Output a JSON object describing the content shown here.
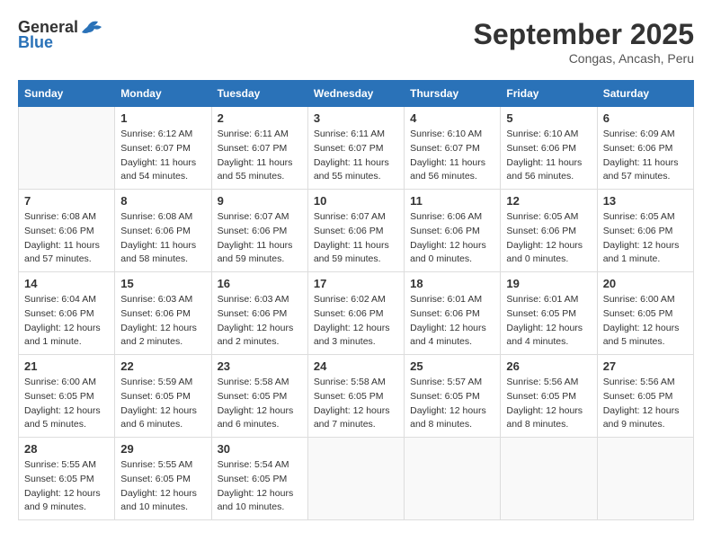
{
  "logo": {
    "text1": "General",
    "text2": "Blue"
  },
  "title": "September 2025",
  "subtitle": "Congas, Ancash, Peru",
  "days_of_week": [
    "Sunday",
    "Monday",
    "Tuesday",
    "Wednesday",
    "Thursday",
    "Friday",
    "Saturday"
  ],
  "weeks": [
    [
      {
        "day": "",
        "info": ""
      },
      {
        "day": "1",
        "info": "Sunrise: 6:12 AM\nSunset: 6:07 PM\nDaylight: 11 hours\nand 54 minutes."
      },
      {
        "day": "2",
        "info": "Sunrise: 6:11 AM\nSunset: 6:07 PM\nDaylight: 11 hours\nand 55 minutes."
      },
      {
        "day": "3",
        "info": "Sunrise: 6:11 AM\nSunset: 6:07 PM\nDaylight: 11 hours\nand 55 minutes."
      },
      {
        "day": "4",
        "info": "Sunrise: 6:10 AM\nSunset: 6:07 PM\nDaylight: 11 hours\nand 56 minutes."
      },
      {
        "day": "5",
        "info": "Sunrise: 6:10 AM\nSunset: 6:06 PM\nDaylight: 11 hours\nand 56 minutes."
      },
      {
        "day": "6",
        "info": "Sunrise: 6:09 AM\nSunset: 6:06 PM\nDaylight: 11 hours\nand 57 minutes."
      }
    ],
    [
      {
        "day": "7",
        "info": "Sunrise: 6:08 AM\nSunset: 6:06 PM\nDaylight: 11 hours\nand 57 minutes."
      },
      {
        "day": "8",
        "info": "Sunrise: 6:08 AM\nSunset: 6:06 PM\nDaylight: 11 hours\nand 58 minutes."
      },
      {
        "day": "9",
        "info": "Sunrise: 6:07 AM\nSunset: 6:06 PM\nDaylight: 11 hours\nand 59 minutes."
      },
      {
        "day": "10",
        "info": "Sunrise: 6:07 AM\nSunset: 6:06 PM\nDaylight: 11 hours\nand 59 minutes."
      },
      {
        "day": "11",
        "info": "Sunrise: 6:06 AM\nSunset: 6:06 PM\nDaylight: 12 hours\nand 0 minutes."
      },
      {
        "day": "12",
        "info": "Sunrise: 6:05 AM\nSunset: 6:06 PM\nDaylight: 12 hours\nand 0 minutes."
      },
      {
        "day": "13",
        "info": "Sunrise: 6:05 AM\nSunset: 6:06 PM\nDaylight: 12 hours\nand 1 minute."
      }
    ],
    [
      {
        "day": "14",
        "info": "Sunrise: 6:04 AM\nSunset: 6:06 PM\nDaylight: 12 hours\nand 1 minute."
      },
      {
        "day": "15",
        "info": "Sunrise: 6:03 AM\nSunset: 6:06 PM\nDaylight: 12 hours\nand 2 minutes."
      },
      {
        "day": "16",
        "info": "Sunrise: 6:03 AM\nSunset: 6:06 PM\nDaylight: 12 hours\nand 2 minutes."
      },
      {
        "day": "17",
        "info": "Sunrise: 6:02 AM\nSunset: 6:06 PM\nDaylight: 12 hours\nand 3 minutes."
      },
      {
        "day": "18",
        "info": "Sunrise: 6:01 AM\nSunset: 6:06 PM\nDaylight: 12 hours\nand 4 minutes."
      },
      {
        "day": "19",
        "info": "Sunrise: 6:01 AM\nSunset: 6:05 PM\nDaylight: 12 hours\nand 4 minutes."
      },
      {
        "day": "20",
        "info": "Sunrise: 6:00 AM\nSunset: 6:05 PM\nDaylight: 12 hours\nand 5 minutes."
      }
    ],
    [
      {
        "day": "21",
        "info": "Sunrise: 6:00 AM\nSunset: 6:05 PM\nDaylight: 12 hours\nand 5 minutes."
      },
      {
        "day": "22",
        "info": "Sunrise: 5:59 AM\nSunset: 6:05 PM\nDaylight: 12 hours\nand 6 minutes."
      },
      {
        "day": "23",
        "info": "Sunrise: 5:58 AM\nSunset: 6:05 PM\nDaylight: 12 hours\nand 6 minutes."
      },
      {
        "day": "24",
        "info": "Sunrise: 5:58 AM\nSunset: 6:05 PM\nDaylight: 12 hours\nand 7 minutes."
      },
      {
        "day": "25",
        "info": "Sunrise: 5:57 AM\nSunset: 6:05 PM\nDaylight: 12 hours\nand 8 minutes."
      },
      {
        "day": "26",
        "info": "Sunrise: 5:56 AM\nSunset: 6:05 PM\nDaylight: 12 hours\nand 8 minutes."
      },
      {
        "day": "27",
        "info": "Sunrise: 5:56 AM\nSunset: 6:05 PM\nDaylight: 12 hours\nand 9 minutes."
      }
    ],
    [
      {
        "day": "28",
        "info": "Sunrise: 5:55 AM\nSunset: 6:05 PM\nDaylight: 12 hours\nand 9 minutes."
      },
      {
        "day": "29",
        "info": "Sunrise: 5:55 AM\nSunset: 6:05 PM\nDaylight: 12 hours\nand 10 minutes."
      },
      {
        "day": "30",
        "info": "Sunrise: 5:54 AM\nSunset: 6:05 PM\nDaylight: 12 hours\nand 10 minutes."
      },
      {
        "day": "",
        "info": ""
      },
      {
        "day": "",
        "info": ""
      },
      {
        "day": "",
        "info": ""
      },
      {
        "day": "",
        "info": ""
      }
    ]
  ]
}
